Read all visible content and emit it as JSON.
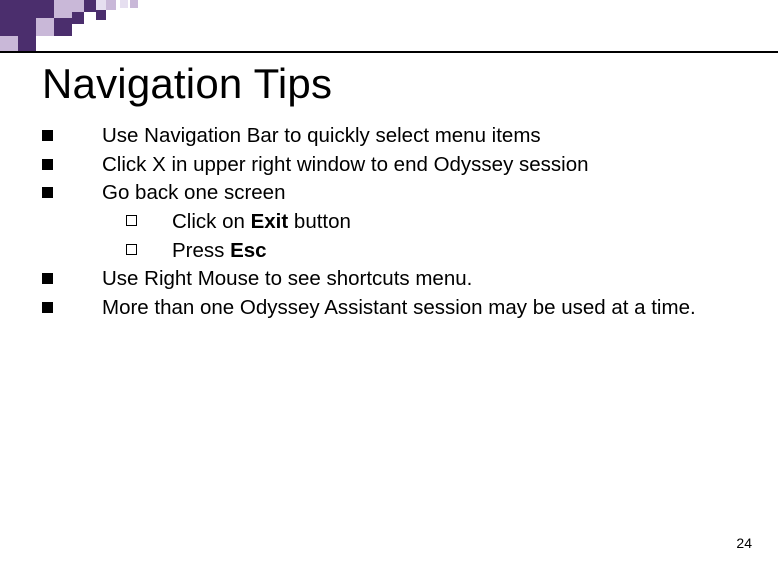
{
  "title": "Navigation Tips",
  "bullets": {
    "b0": "Use Navigation Bar to quickly select menu items",
    "b1": "Click X in upper right window to end Odyssey session",
    "b2": "Go back one screen",
    "b2_sub": {
      "s0_pre": "Click on ",
      "s0_bold": "Exit",
      "s0_post": " button",
      "s1_pre": "Press ",
      "s1_bold": "Esc"
    },
    "b3": "Use Right Mouse to see shortcuts menu.",
    "b4": "More than one Odyssey Assistant session may be used at a time."
  },
  "page_number": "24",
  "colors": {
    "accent_dark": "#4b2e6d",
    "accent_light": "#c9b8d8",
    "accent_lighter": "#e6dff0"
  }
}
